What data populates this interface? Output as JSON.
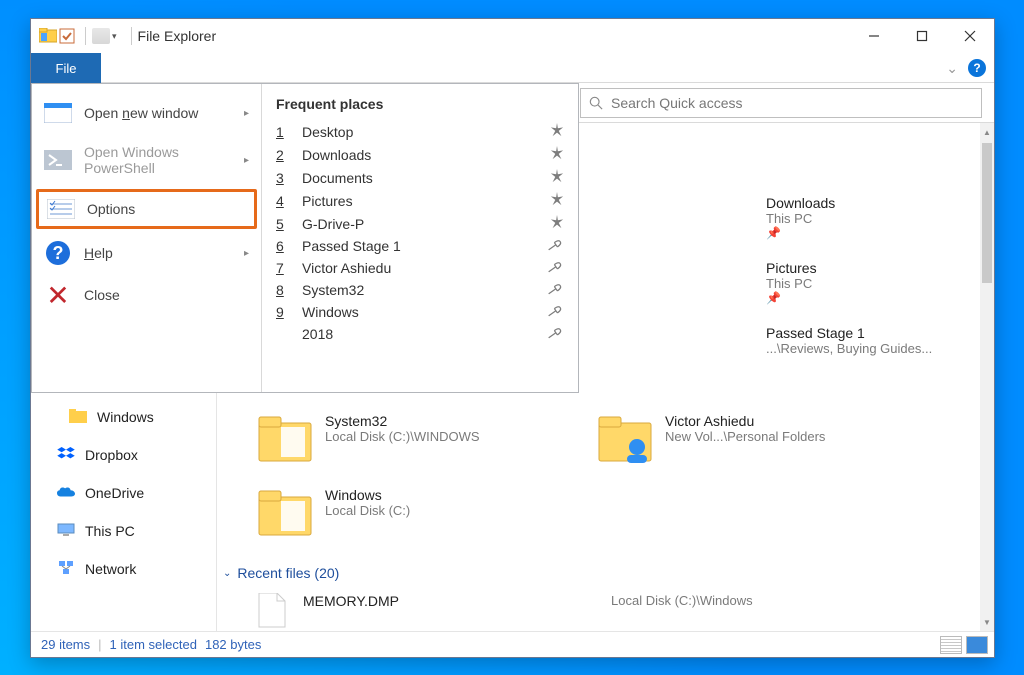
{
  "window": {
    "title": "File Explorer"
  },
  "file_tab": "File",
  "search": {
    "placeholder": "Search Quick access"
  },
  "file_menu": {
    "open_new_window": "Open new window",
    "open_powershell": "Open Windows PowerShell",
    "options": "Options",
    "help": "Help",
    "close": "Close",
    "frequent_title": "Frequent places",
    "items": [
      {
        "n": "1",
        "label": "Desktop",
        "pin": "star"
      },
      {
        "n": "2",
        "label": "Downloads",
        "pin": "star"
      },
      {
        "n": "3",
        "label": "Documents",
        "pin": "star"
      },
      {
        "n": "4",
        "label": "Pictures",
        "pin": "star"
      },
      {
        "n": "5",
        "label": "G-Drive-P",
        "pin": "star"
      },
      {
        "n": "6",
        "label": "Passed Stage 1",
        "pin": "tack"
      },
      {
        "n": "7",
        "label": "Victor Ashiedu",
        "pin": "tack"
      },
      {
        "n": "8",
        "label": "System32",
        "pin": "tack"
      },
      {
        "n": "9",
        "label": "Windows",
        "pin": "tack"
      },
      {
        "n": "",
        "label": "2018",
        "pin": "tack"
      }
    ]
  },
  "right_pinned": [
    {
      "name": "Downloads",
      "sub": "This PC"
    },
    {
      "name": "Pictures",
      "sub": "This PC"
    },
    {
      "name": "Passed Stage 1",
      "sub": "...\\Reviews, Buying Guides..."
    }
  ],
  "nav": {
    "windows": "Windows",
    "dropbox": "Dropbox",
    "onedrive": "OneDrive",
    "thispc": "This PC",
    "network": "Network"
  },
  "content": {
    "system32": {
      "name": "System32",
      "sub": "Local Disk (C:)\\WINDOWS"
    },
    "victor": {
      "name": "Victor Ashiedu",
      "sub": "New Vol...\\Personal Folders"
    },
    "windows": {
      "name": "Windows",
      "sub": "Local Disk (C:)"
    },
    "recent_header": "Recent files (20)",
    "memory_dmp": {
      "name": "MEMORY.DMP",
      "sub": "Local Disk (C:)\\Windows"
    }
  },
  "status": {
    "items": "29 items",
    "selected": "1 item selected",
    "size": "182 bytes"
  }
}
